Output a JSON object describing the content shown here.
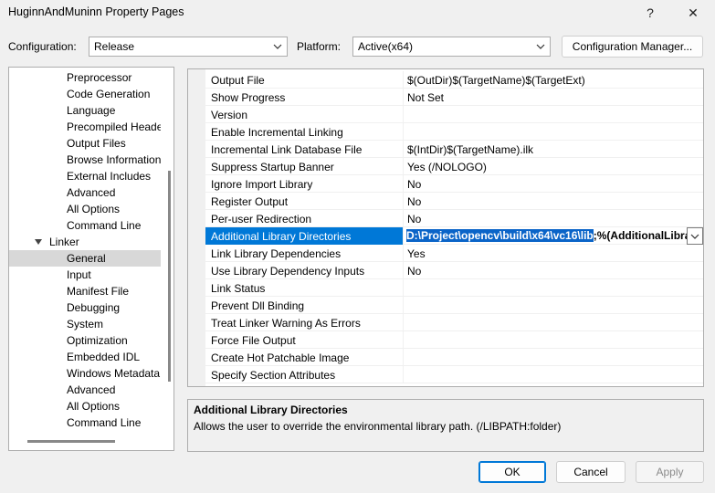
{
  "window": {
    "title": "HuginnAndMuninn Property Pages",
    "help": "?",
    "close": "✕"
  },
  "config": {
    "configuration_label": "Configuration:",
    "configuration_value": "Release",
    "platform_label": "Platform:",
    "platform_value": "Active(x64)",
    "manager_button": "Configuration Manager..."
  },
  "tree": {
    "items": [
      {
        "label": "Preprocessor",
        "level": 2
      },
      {
        "label": "Code Generation",
        "level": 2
      },
      {
        "label": "Language",
        "level": 2
      },
      {
        "label": "Precompiled Heade",
        "level": 2
      },
      {
        "label": "Output Files",
        "level": 2
      },
      {
        "label": "Browse Information",
        "level": 2
      },
      {
        "label": "External Includes",
        "level": 2
      },
      {
        "label": "Advanced",
        "level": 2
      },
      {
        "label": "All Options",
        "level": 2
      },
      {
        "label": "Command Line",
        "level": 2
      },
      {
        "label": "Linker",
        "level": 1,
        "expanded": true
      },
      {
        "label": "General",
        "level": 2,
        "selected": true
      },
      {
        "label": "Input",
        "level": 2
      },
      {
        "label": "Manifest File",
        "level": 2
      },
      {
        "label": "Debugging",
        "level": 2
      },
      {
        "label": "System",
        "level": 2
      },
      {
        "label": "Optimization",
        "level": 2
      },
      {
        "label": "Embedded IDL",
        "level": 2
      },
      {
        "label": "Windows Metadata",
        "level": 2
      },
      {
        "label": "Advanced",
        "level": 2
      },
      {
        "label": "All Options",
        "level": 2
      },
      {
        "label": "Command Line",
        "level": 2
      }
    ]
  },
  "grid": {
    "rows": [
      {
        "name": "Output File",
        "value": "$(OutDir)$(TargetName)$(TargetExt)"
      },
      {
        "name": "Show Progress",
        "value": "Not Set"
      },
      {
        "name": "Version",
        "value": ""
      },
      {
        "name": "Enable Incremental Linking",
        "value": ""
      },
      {
        "name": "Incremental Link Database File",
        "value": "$(IntDir)$(TargetName).ilk"
      },
      {
        "name": "Suppress Startup Banner",
        "value": "Yes (/NOLOGO)"
      },
      {
        "name": "Ignore Import Library",
        "value": "No"
      },
      {
        "name": "Register Output",
        "value": "No"
      },
      {
        "name": "Per-user Redirection",
        "value": "No"
      },
      {
        "name": "Additional Library Directories",
        "value": "",
        "selected": true
      },
      {
        "name": "Link Library Dependencies",
        "value": "Yes"
      },
      {
        "name": "Use Library Dependency Inputs",
        "value": "No"
      },
      {
        "name": "Link Status",
        "value": ""
      },
      {
        "name": "Prevent Dll Binding",
        "value": ""
      },
      {
        "name": "Treat Linker Warning As Errors",
        "value": ""
      },
      {
        "name": "Force File Output",
        "value": ""
      },
      {
        "name": "Create Hot Patchable Image",
        "value": ""
      },
      {
        "name": "Specify Section Attributes",
        "value": ""
      }
    ],
    "selected_edit": {
      "highlighted": "D:\\Project\\opencv\\build\\x64\\vc16\\lib",
      "rest": ";%(AdditionalLibra"
    }
  },
  "description": {
    "title": "Additional Library Directories",
    "text": "Allows the user to override the environmental library path. (/LIBPATH:folder)"
  },
  "buttons": {
    "ok": "OK",
    "cancel": "Cancel",
    "apply": "Apply"
  },
  "colors": {
    "selection": "#0078d7",
    "tree_selected": "#d8d8d8",
    "apply_disabled_text": "#8a8a8a"
  }
}
